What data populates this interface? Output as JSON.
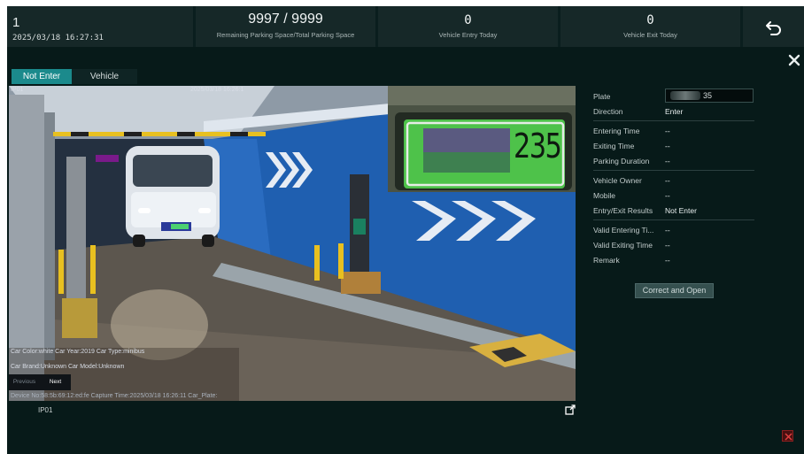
{
  "header": {
    "index": "1",
    "datetime": "2025/03/18 16:27:31",
    "spaces_value": "9997 / 9999",
    "spaces_label": "Remaining Parking Space/Total Parking Space",
    "entry_value": "0",
    "entry_label": "Vehicle Entry Today",
    "exit_value": "0",
    "exit_label": "Vehicle Exit Today",
    "back_icon": "undo-arrow-icon"
  },
  "tabs": [
    {
      "label": "Not Enter",
      "active": true
    },
    {
      "label": "Vehicle Exiting",
      "active": false
    }
  ],
  "camera": {
    "osd_top_left": "IP01",
    "osd_datetime": "2025/03/18 16:26:1",
    "plate_on_image": "235",
    "car_info_line1": "Car Color:white   Car Year:2019   Car Type:minibus",
    "car_info_line2": "Car Brand:Unknown   Car Model:Unknown",
    "device_line": "Device No:58:5b:69:12:ed:fe  Capture Time:2025/03/18 16:26:11  Car_Plate:",
    "prev_label": "Previous",
    "next_label": "Next",
    "channel_label": "IP01",
    "export_icon": "export-icon"
  },
  "details": {
    "plate_label": "Plate",
    "plate_value": "35",
    "direction_label": "Direction",
    "direction_value": "Enter",
    "entering_time_label": "Entering Time",
    "entering_time_value": "--",
    "exiting_time_label": "Exiting Time",
    "exiting_time_value": "--",
    "parking_duration_label": "Parking Duration",
    "parking_duration_value": "--",
    "vehicle_owner_label": "Vehicle Owner",
    "vehicle_owner_value": "--",
    "mobile_label": "Mobile",
    "mobile_value": "--",
    "entry_exit_label": "Entry/Exit Results",
    "entry_exit_value": "Not Enter",
    "valid_entering_label": "Valid Entering Ti...",
    "valid_entering_value": "--",
    "valid_exiting_label": "Valid Exiting Time",
    "valid_exiting_value": "--",
    "remark_label": "Remark",
    "remark_value": "--"
  },
  "actions": {
    "correct_open_label": "Correct and Open"
  },
  "colors": {
    "accent": "#1b8a8c",
    "background": "#071a19",
    "panel": "#162828"
  }
}
